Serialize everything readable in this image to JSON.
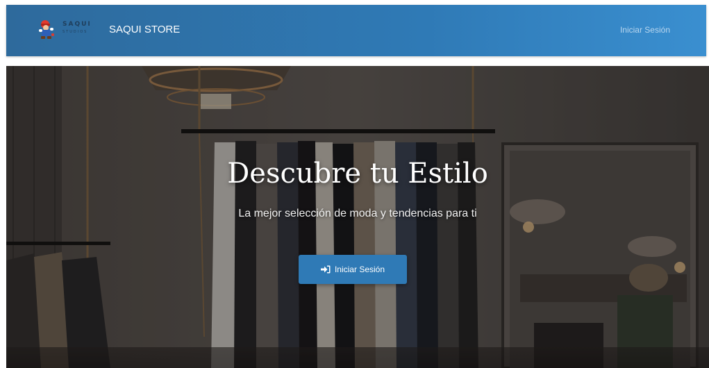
{
  "navbar": {
    "logo_text": "SAQUI",
    "logo_subtext": "STUDIOS",
    "brand_name": "SAQUI STORE",
    "login_link": "Iniciar Sesión",
    "background_color": "#2f7ab6"
  },
  "hero": {
    "title": "Descubre tu Estilo",
    "subtitle": "La mejor selección de moda y tendencias para ti",
    "button_label": "Iniciar Sesión",
    "button_icon": "sign-in-icon",
    "button_color": "#2f7ab6"
  }
}
